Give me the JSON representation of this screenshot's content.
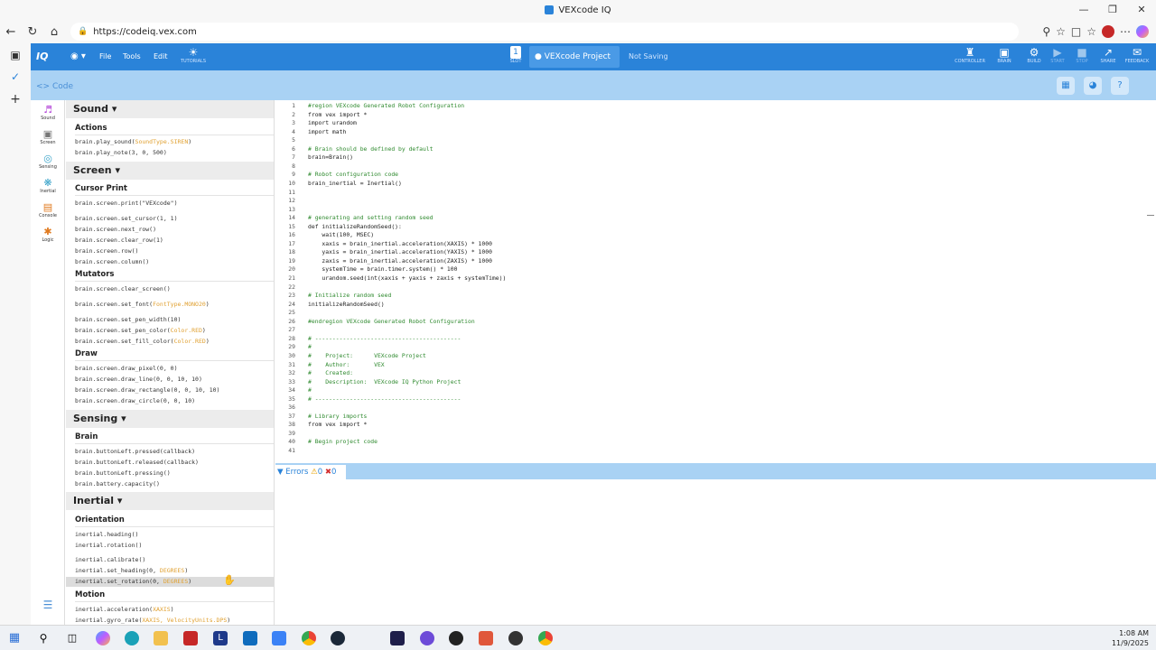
{
  "browser": {
    "window_title": "VEXcode IQ",
    "url": "https://codeiq.vex.com"
  },
  "app": {
    "logo": "IQ",
    "menu": {
      "file": "File",
      "tools": "Tools",
      "edit": "Edit",
      "tutorials": "TUTORIALS"
    },
    "slot_label": "SLOT",
    "slot_number": "1",
    "project_name": "VEXcode Project",
    "save_status": "Not Saving",
    "right_actions": [
      "CONTROLLER",
      "BRAIN",
      "BUILD",
      "START",
      "STOP",
      "SHARE",
      "FEEDBACK"
    ],
    "code_tab": "Code",
    "accent": "#2a83d9"
  },
  "categories": [
    "Sound",
    "Screen",
    "Sensing",
    "Inertial",
    "Console",
    "Logic"
  ],
  "toolbox": {
    "sound": "Sound",
    "sound_actions": "Actions",
    "sound_cmds": [
      "brain.play_sound(",
      "SoundType.SIREN",
      ")",
      "brain.play_note(3, 0, 500)"
    ],
    "screen": "Screen",
    "cursor_print": "Cursor Print",
    "screen_cmds": [
      "brain.screen.print(\"VEXcode\")",
      "brain.screen.set_cursor(1, 1)",
      "brain.screen.next_row()",
      "brain.screen.clear_row(1)",
      "brain.screen.row()",
      "brain.screen.column()"
    ],
    "mutators": "Mutators",
    "mutator_cmds": {
      "clear": "brain.screen.clear_screen()",
      "font_a": "brain.screen.set_font(",
      "font_b": "FontType.MONO20",
      "font_c": ")",
      "pen_width": "brain.screen.set_pen_width(10)",
      "pen_color_a": "brain.screen.set_pen_color(",
      "pen_color_b": "Color.RED",
      "pen_color_c": ")",
      "fill_color_a": "brain.screen.set_fill_color(",
      "fill_color_b": "Color.RED",
      "fill_color_c": ")"
    },
    "draw": "Draw",
    "draw_cmds": [
      "brain.screen.draw_pixel(0, 0)",
      "brain.screen.draw_line(0, 0, 10, 10)",
      "brain.screen.draw_rectangle(0, 0, 10, 10)",
      "brain.screen.draw_circle(0, 0, 10)"
    ],
    "sensing": "Sensing",
    "brain": "Brain",
    "brain_cmds": [
      "brain.buttonLeft.pressed(callback)",
      "brain.buttonLeft.released(callback)",
      "brain.buttonLeft.pressing()",
      "brain.battery.capacity()"
    ],
    "inertial": "Inertial",
    "orientation": "Orientation",
    "orient_cmds": {
      "heading": "inertial.heading()",
      "rotation": "inertial.rotation()",
      "calibrate": "inertial.calibrate()",
      "set_heading_a": "inertial.set_heading(0, ",
      "set_heading_b": "DEGREES",
      "set_heading_c": ")",
      "set_rotation_a": "inertial.set_rotation(0, ",
      "set_rotation_b": "DEGREES",
      "set_rotation_c": ")"
    },
    "motion": "Motion",
    "motion_cmds": {
      "accel_a": "inertial.acceleration(",
      "accel_b": "XAXIS",
      "accel_c": ")",
      "gyro_a": "inertial.gyro_rate(",
      "gyro_b": "XAXIS, VelocityUnits.DPS",
      "gyro_c": ")"
    }
  },
  "editor": {
    "lines": [
      "#region VEXcode Generated Robot Configuration",
      "from vex import *",
      "import urandom",
      "import math",
      "",
      "# Brain should be defined by default",
      "brain=Brain()",
      "",
      "# Robot configuration code",
      "brain_inertial = Inertial()",
      "",
      "",
      "",
      "# generating and setting random seed",
      "def initializeRandomSeed():",
      "    wait(100, MSEC)",
      "    xaxis = brain_inertial.acceleration(XAXIS) * 1000",
      "    yaxis = brain_inertial.acceleration(YAXIS) * 1000",
      "    zaxis = brain_inertial.acceleration(ZAXIS) * 1000",
      "    systemTime = brain.timer.system() * 100",
      "    urandom.seed(int(xaxis + yaxis + zaxis + systemTime))",
      "",
      "# Initialize random seed",
      "initializeRandomSeed()",
      "",
      "#endregion VEXcode Generated Robot Configuration",
      "",
      "# ------------------------------------------",
      "#",
      "#    Project:      VEXcode Project",
      "#    Author:       VEX",
      "#    Created:",
      "#    Description:  VEXcode IQ Python Project",
      "#",
      "# ------------------------------------------",
      "",
      "# Library imports",
      "from vex import *",
      "",
      "# Begin project code",
      ""
    ]
  },
  "errors": {
    "label": "Errors",
    "warnings": "0",
    "errors": "0"
  },
  "taskbar": {
    "time": "1:08 AM",
    "date": "11/9/2025"
  }
}
